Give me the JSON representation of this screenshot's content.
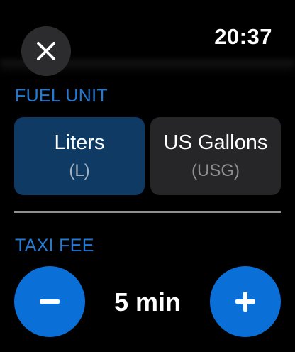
{
  "status": {
    "time": "20:37"
  },
  "icons": {
    "close": "close-icon",
    "minus": "minus-icon",
    "plus": "plus-icon"
  },
  "fuel_unit": {
    "label": "FUEL UNIT",
    "selected": "Liters",
    "options": [
      {
        "name": "Liters",
        "abbr": "(L)"
      },
      {
        "name": "US Gallons",
        "abbr": "(USG)"
      }
    ]
  },
  "taxi_fee": {
    "label": "TAXI FEE",
    "value": "5 min"
  },
  "colors": {
    "accent": "#1f7ad8",
    "button_blue": "#0a6fd6",
    "selected_bg": "#0f3a64",
    "unselected_bg": "#262628",
    "close_bg": "#2c2c2e"
  }
}
